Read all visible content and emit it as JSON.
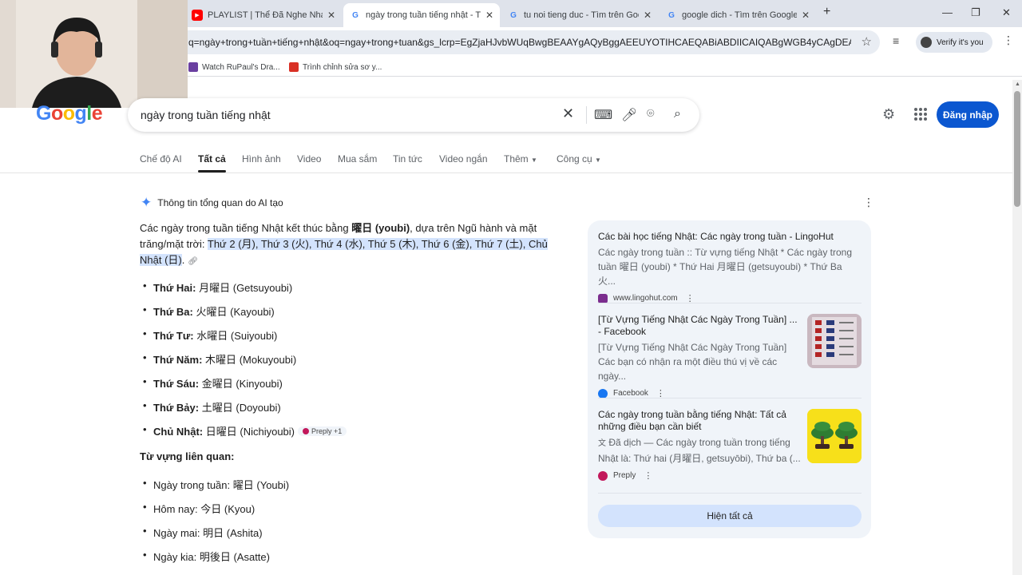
{
  "browser": {
    "tabs": [
      {
        "label": "PLAYLIST | Thể Đã Nghe Nhạc D",
        "icon": "youtube-icon"
      },
      {
        "label": "ngày trong tuần tiếng nhật - Tì",
        "icon": "google-icon",
        "active": true
      },
      {
        "label": "tu noi tieng duc - Tìm trên Goo",
        "icon": "google-icon"
      },
      {
        "label": "google dich - Tìm trên Google",
        "icon": "google-icon"
      }
    ],
    "url": "q=ngày+trong+tuần+tiếng+nhật&oq=ngay+trong+tuan&gs_lcrp=EgZjaHJvbWUqBwgBEAAYgAQyBggAEEUYOTIHCAEQABiABDIICAIQABgWGB4yCAgDEAAYFh...",
    "profile_label": "Verify it's you",
    "bookmarks": [
      "Watch RuPaul's Dra...",
      "Trình chỉnh sửa sơ y..."
    ]
  },
  "google": {
    "logo_text": "Google",
    "query": "ngày trong tuần tiếng nhật",
    "signin_label": "Đăng nhập",
    "nav_tabs": [
      "Chế độ AI",
      "Tất cả",
      "Hình ảnh",
      "Video",
      "Mua sắm",
      "Tin tức",
      "Video ngắn",
      "Thêm",
      "Công cụ"
    ]
  },
  "ai_overview": {
    "heading": "Thông tin tổng quan do AI tạo",
    "summary_pre": "Các ngày trong tuần tiếng Nhật kết thúc bằng ",
    "summary_bold": "曜日 (youbi)",
    "summary_mid": ", dựa trên Ngũ hành và mặt trăng/mặt trời: ",
    "summary_highlight": "Thứ 2 (月), Thứ 3 (火), Thứ 4 (水), Thứ 5 (木), Thứ 6 (金), Thứ 7 (土), Chủ Nhật (日)",
    "summary_end": ".",
    "days": [
      {
        "day": "Thứ Hai:",
        "kanji": "月曜日",
        "romaji": "(Getsuyoubi)"
      },
      {
        "day": "Thứ Ba:",
        "kanji": "火曜日",
        "romaji": "(Kayoubi)"
      },
      {
        "day": "Thứ Tư:",
        "kanji": "水曜日",
        "romaji": "(Suiyoubi)"
      },
      {
        "day": "Thứ Năm:",
        "kanji": "木曜日",
        "romaji": "(Mokuyoubi)"
      },
      {
        "day": "Thứ Sáu:",
        "kanji": "金曜日",
        "romaji": "(Kinyoubi)"
      },
      {
        "day": "Thứ Bảy:",
        "kanji": "土曜日",
        "romaji": "(Doyoubi)"
      },
      {
        "day": "Chủ Nhật:",
        "kanji": "日曜日",
        "romaji": "(Nichiyoubi)"
      }
    ],
    "chip_label": "Preply +1",
    "related_title": "Từ vựng liên quan:",
    "related": [
      {
        "label": "Ngày trong tuần:",
        "kanji": "曜日",
        "romaji": "(Youbi)"
      },
      {
        "label": "Hôm nay:",
        "kanji": "今日",
        "romaji": "(Kyou)"
      },
      {
        "label": "Ngày mai:",
        "kanji": "明日",
        "romaji": "(Ashita)"
      },
      {
        "label": "Ngày kia:",
        "kanji": "明後日",
        "romaji": "(Asatte)"
      }
    ]
  },
  "sources": {
    "items": [
      {
        "title": "Các bài học tiếng Nhật: Các ngày trong tuần - LingoHut",
        "snippet": "Các ngày trong tuần :: Từ vựng tiếng Nhật * Các ngày trong tuần 曜日 (youbi) * Thứ Hai 月曜日 (getsuyoubi) * Thứ Ba 火...",
        "site": "www.lingohut.com"
      },
      {
        "title": "[Từ Vựng Tiếng Nhật Các Ngày Trong Tuần] ... - Facebook",
        "snippet": "[Từ Vựng Tiếng Nhật Các Ngày Trong Tuần] Các bạn có nhận ra một điều thú vị về các ngày...",
        "site": "Facebook"
      },
      {
        "title": "Các ngày trong tuần bằng tiếng Nhật: Tất cả những điều bạn cần biết",
        "snippet": "Đã dịch — Các ngày trong tuần trong tiếng Nhật là: Thứ hai (月曜日, getsuyōbi), Thứ ba (...",
        "site": "Preply"
      }
    ],
    "show_all": "Hiện tất cả"
  }
}
